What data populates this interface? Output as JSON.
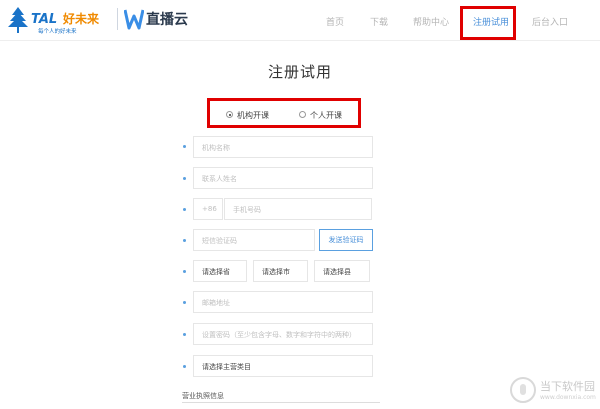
{
  "header": {
    "brand": {
      "tal_text": "TAL",
      "tal_cn": "好未来",
      "tal_slogan": "每个人的好未来",
      "zbc_name": "直播云"
    },
    "nav": [
      {
        "label": "首页"
      },
      {
        "label": "下载"
      },
      {
        "label": "帮助中心"
      },
      {
        "label": "注册试用"
      },
      {
        "label": "后台入口"
      }
    ],
    "active_nav": "注册试用",
    "accent_color": "#4a90d9",
    "highlight_color": "#e00000"
  },
  "page": {
    "title": "注册试用"
  },
  "account_type": {
    "options": [
      {
        "label": "机构开课",
        "selected": true
      },
      {
        "label": "个人开课",
        "selected": false
      }
    ]
  },
  "form": {
    "org_name_placeholder": "机构名称",
    "contact_name_placeholder": "联系人姓名",
    "phone_prefix": "+86",
    "phone_placeholder": "手机号码",
    "sms_code_placeholder": "短信验证码",
    "send_code_label": "发送验证码",
    "province_label": "请选择省",
    "city_label": "请选择市",
    "county_label": "请选择县",
    "email_placeholder": "邮箱地址",
    "password_placeholder": "设置密码（至少包含字母、数字和字符中的两种）",
    "category_label": "请选择主营类目",
    "license_section": "营业执照信息"
  },
  "watermark": {
    "title": "当下软件园",
    "url": "www.downxia.com"
  }
}
